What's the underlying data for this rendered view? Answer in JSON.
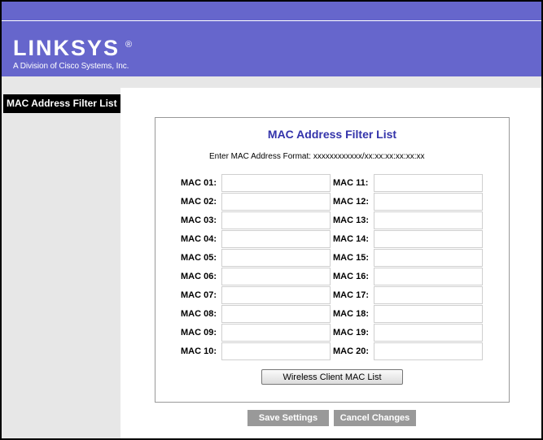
{
  "brand": {
    "logo_text": "LINKSYS",
    "registered_mark": "®",
    "subtitle": "A Division of Cisco Systems, Inc."
  },
  "sidebar": {
    "title": "MAC Address Filter List"
  },
  "panel": {
    "title": "MAC Address Filter List",
    "format_hint": "Enter MAC Address Format: xxxxxxxxxxxx/xx:xx:xx:xx:xx:xx"
  },
  "mac_fields": {
    "left": [
      {
        "label": "MAC 01:",
        "value": ""
      },
      {
        "label": "MAC 02:",
        "value": ""
      },
      {
        "label": "MAC 03:",
        "value": ""
      },
      {
        "label": "MAC 04:",
        "value": ""
      },
      {
        "label": "MAC 05:",
        "value": ""
      },
      {
        "label": "MAC 06:",
        "value": ""
      },
      {
        "label": "MAC 07:",
        "value": ""
      },
      {
        "label": "MAC 08:",
        "value": ""
      },
      {
        "label": "MAC 09:",
        "value": ""
      },
      {
        "label": "MAC 10:",
        "value": ""
      }
    ],
    "right": [
      {
        "label": "MAC 11:",
        "value": ""
      },
      {
        "label": "MAC 12:",
        "value": ""
      },
      {
        "label": "MAC 13:",
        "value": ""
      },
      {
        "label": "MAC 14:",
        "value": ""
      },
      {
        "label": "MAC 15:",
        "value": ""
      },
      {
        "label": "MAC 16:",
        "value": ""
      },
      {
        "label": "MAC 17:",
        "value": ""
      },
      {
        "label": "MAC 18:",
        "value": ""
      },
      {
        "label": "MAC 19:",
        "value": ""
      },
      {
        "label": "MAC 20:",
        "value": ""
      }
    ]
  },
  "buttons": {
    "wireless_client": "Wireless Client MAC List",
    "save": "Save Settings",
    "cancel": "Cancel Changes"
  },
  "colors": {
    "header": "#6666cc",
    "panel_title": "#3333aa",
    "sidebar_bg": "#e7e7e7",
    "action_button": "#999999"
  }
}
